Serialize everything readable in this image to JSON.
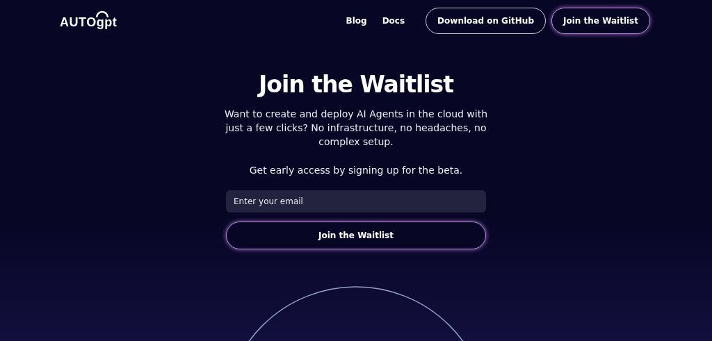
{
  "header": {
    "logo": "AUTOgpt",
    "nav": [
      {
        "label": "Blog"
      },
      {
        "label": "Docs"
      }
    ],
    "buttons": [
      {
        "label": "Download on GitHub",
        "kind": "outline"
      },
      {
        "label": "Join the Waitlist",
        "kind": "glow"
      }
    ]
  },
  "hero": {
    "title": "Join the Waitlist",
    "description": "Want to create and deploy AI Agents in the cloud with just a few clicks? No infrastructure, no headaches, no complex setup.",
    "note": "Get early access by signing up for the beta.",
    "email": {
      "placeholder": "Enter your email"
    },
    "submit": "Join the Waitlist"
  }
}
